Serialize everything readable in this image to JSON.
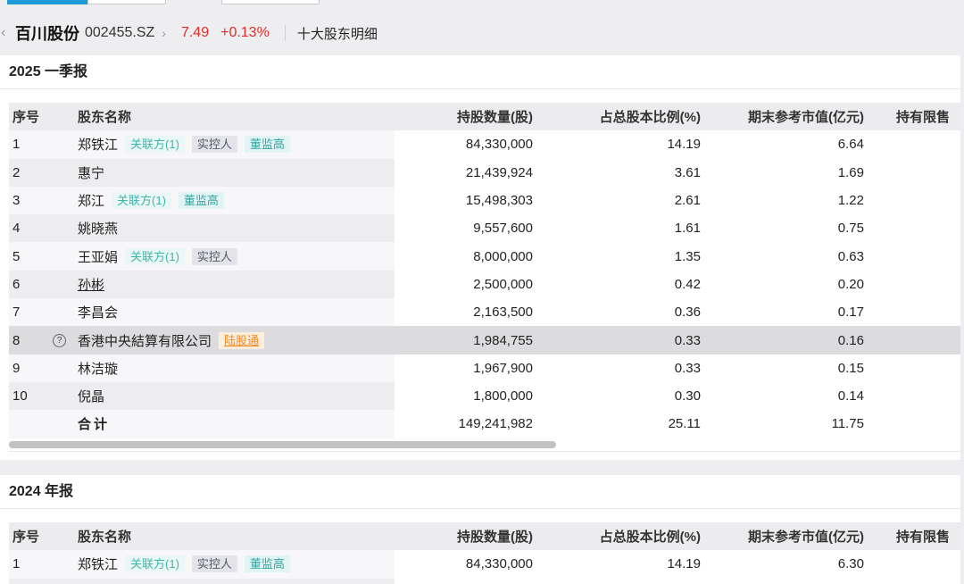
{
  "header": {
    "stock_name": "百川股份",
    "stock_code": "002455.SZ",
    "price": "7.49",
    "change": "+0.13%",
    "page_title": "十大股东明细"
  },
  "columns": [
    "序号",
    "股东名称",
    "持股数量(股)",
    "占总股本比例(%)",
    "期末参考市值(亿元)",
    "持有限售"
  ],
  "tags": {
    "related": "关联方(1)",
    "controller": "实控人",
    "director": "董监高",
    "hk_connect": "陆股通"
  },
  "q1": {
    "title": "2025 一季报",
    "rows": [
      {
        "idx": "1",
        "name": "郑铁江",
        "shares": "84,330,000",
        "pct": "14.19",
        "mv": "6.64"
      },
      {
        "idx": "2",
        "name": "惠宁",
        "shares": "21,439,924",
        "pct": "3.61",
        "mv": "1.69"
      },
      {
        "idx": "3",
        "name": "郑江",
        "shares": "15,498,303",
        "pct": "2.61",
        "mv": "1.22"
      },
      {
        "idx": "4",
        "name": "姚晓燕",
        "shares": "9,557,600",
        "pct": "1.61",
        "mv": "0.75"
      },
      {
        "idx": "5",
        "name": "王亚娟",
        "shares": "8,000,000",
        "pct": "1.35",
        "mv": "0.63"
      },
      {
        "idx": "6",
        "name": "孙彬",
        "shares": "2,500,000",
        "pct": "0.42",
        "mv": "0.20"
      },
      {
        "idx": "7",
        "name": "李昌会",
        "shares": "2,163,500",
        "pct": "0.36",
        "mv": "0.17"
      },
      {
        "idx": "8",
        "name": "香港中央結算有限公司",
        "shares": "1,984,755",
        "pct": "0.33",
        "mv": "0.16"
      },
      {
        "idx": "9",
        "name": "林洁璇",
        "shares": "1,967,900",
        "pct": "0.33",
        "mv": "0.15"
      },
      {
        "idx": "10",
        "name": "倪晶",
        "shares": "1,800,000",
        "pct": "0.30",
        "mv": "0.14"
      }
    ],
    "total": {
      "label": "合计",
      "shares": "149,241,982",
      "pct": "25.11",
      "mv": "11.75"
    }
  },
  "annual": {
    "title": "2024 年报",
    "rows": [
      {
        "idx": "1",
        "name": "郑铁江",
        "shares": "84,330,000",
        "pct": "14.19",
        "mv": "6.30"
      }
    ]
  }
}
